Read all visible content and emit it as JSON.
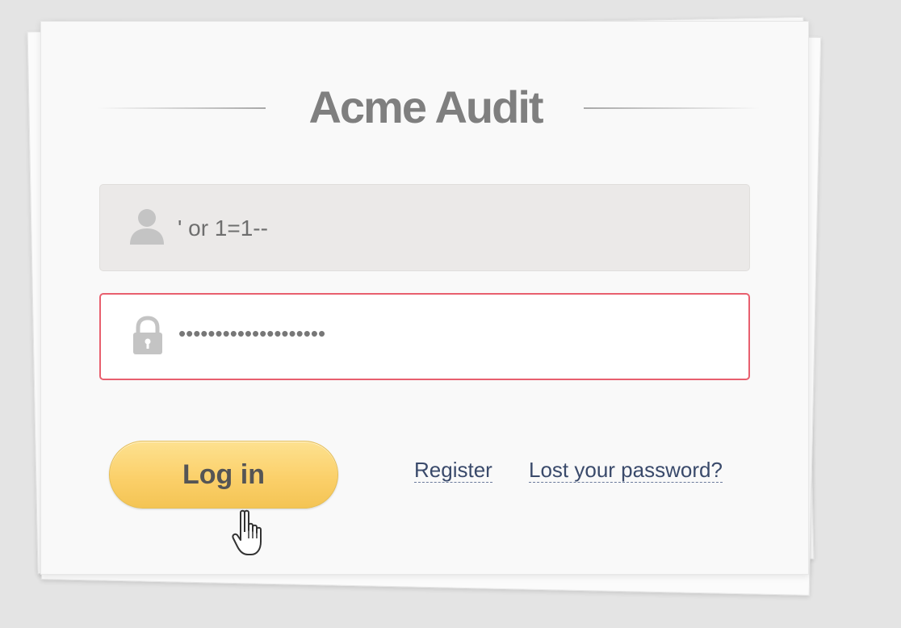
{
  "login": {
    "title": "Acme Audit",
    "username": {
      "value": "' or 1=1--",
      "icon": "user-icon"
    },
    "password": {
      "value": "••••••••••••••••••••",
      "icon": "lock-icon",
      "state": "error"
    },
    "login_button_label": "Log in",
    "register_link": "Register",
    "lost_password_link": "Lost your password?"
  },
  "colors": {
    "background": "#e4e4e4",
    "card": "#f9f9f9",
    "title": "#7f7f7f",
    "username_field": "#ebe9e8",
    "password_border_error": "#e85f6e",
    "button": "#fbd06a",
    "link": "#3a4a6b"
  }
}
